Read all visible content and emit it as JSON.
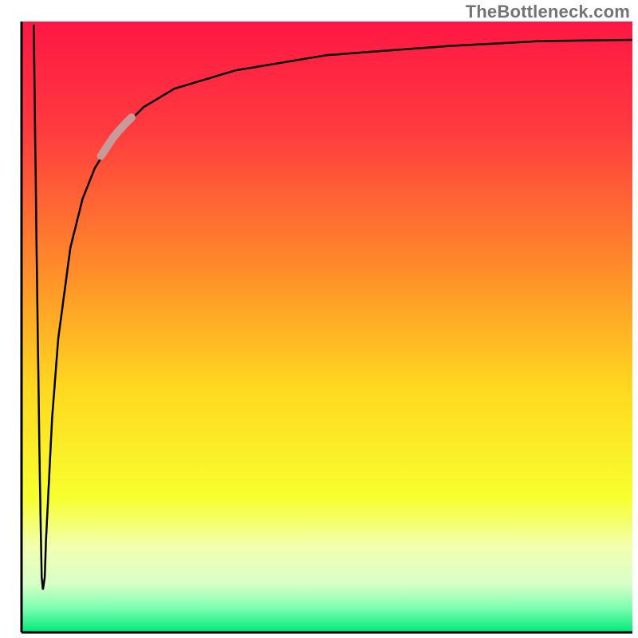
{
  "watermark": "TheBottleneck.com",
  "chart_data": {
    "type": "line",
    "title": "",
    "xlabel": "",
    "ylabel": "",
    "xlim": [
      0,
      100
    ],
    "ylim": [
      0,
      100
    ],
    "grid": false,
    "legend": false,
    "background_gradient_stops": [
      {
        "offset": 0.0,
        "color": "#ff1744"
      },
      {
        "offset": 0.18,
        "color": "#ff3b3f"
      },
      {
        "offset": 0.4,
        "color": "#ff8a2a"
      },
      {
        "offset": 0.6,
        "color": "#ffd81f"
      },
      {
        "offset": 0.78,
        "color": "#f7ff2e"
      },
      {
        "offset": 0.86,
        "color": "#f2ffb0"
      },
      {
        "offset": 0.92,
        "color": "#d8ffc8"
      },
      {
        "offset": 0.96,
        "color": "#7dffb0"
      },
      {
        "offset": 1.0,
        "color": "#00e87a"
      }
    ],
    "series": [
      {
        "name": "bottleneck-curve",
        "stroke": "#000000",
        "x": [
          2.0,
          2.5,
          3.0,
          3.3,
          3.5,
          3.8,
          4.0,
          5.0,
          6.0,
          8.0,
          10.0,
          12.0,
          15.0,
          20.0,
          25.0,
          35.0,
          50.0,
          70.0,
          85.0,
          100.0
        ],
        "values": [
          99.5,
          60.0,
          25.0,
          9.0,
          7.0,
          9.0,
          15.0,
          35.0,
          48.0,
          63.0,
          71.0,
          76.0,
          81.0,
          86.0,
          89.0,
          92.0,
          94.5,
          96.0,
          96.8,
          97.0
        ]
      },
      {
        "name": "highlight-segment",
        "stroke": "#c99a9a",
        "x": [
          13.0,
          14.0,
          15.0,
          16.0,
          17.0,
          18.0
        ],
        "values": [
          78.0,
          79.5,
          81.0,
          82.2,
          83.3,
          84.3
        ]
      }
    ],
    "axis_stroke": "#000000",
    "axis_thickness": 3
  }
}
